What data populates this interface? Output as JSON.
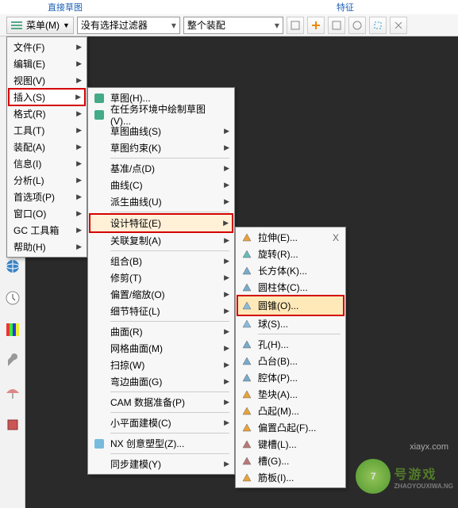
{
  "top": {
    "left": "直接草图",
    "right": "特征"
  },
  "toolbar": {
    "menu_label": "菜单(M)",
    "filter_label": "没有选择过滤器",
    "assembly_label": "整个装配"
  },
  "menu1": [
    {
      "label": "文件(F)",
      "arrow": true
    },
    {
      "label": "编辑(E)",
      "arrow": true
    },
    {
      "label": "视图(V)",
      "arrow": true
    },
    {
      "label": "插入(S)",
      "arrow": true,
      "hi": true
    },
    {
      "label": "格式(R)",
      "arrow": true
    },
    {
      "label": "工具(T)",
      "arrow": true
    },
    {
      "label": "装配(A)",
      "arrow": true
    },
    {
      "label": "信息(I)",
      "arrow": true
    },
    {
      "label": "分析(L)",
      "arrow": true
    },
    {
      "label": "首选项(P)",
      "arrow": true
    },
    {
      "label": "窗口(O)",
      "arrow": true
    },
    {
      "label": "GC 工具箱",
      "arrow": true
    },
    {
      "label": "帮助(H)",
      "arrow": true
    }
  ],
  "menu2": [
    {
      "t": "i",
      "label": "草图(H)...",
      "icon": "#4a8"
    },
    {
      "t": "i",
      "label": "在任务环境中绘制草图(V)...",
      "icon": "#4a8"
    },
    {
      "t": "i",
      "label": "草图曲线(S)",
      "arrow": true
    },
    {
      "t": "i",
      "label": "草图约束(K)",
      "arrow": true
    },
    {
      "t": "s"
    },
    {
      "t": "i",
      "label": "基准/点(D)",
      "arrow": true
    },
    {
      "t": "i",
      "label": "曲线(C)",
      "arrow": true
    },
    {
      "t": "i",
      "label": "派生曲线(U)",
      "arrow": true
    },
    {
      "t": "s"
    },
    {
      "t": "i",
      "label": "设计特征(E)",
      "arrow": true,
      "hi": true
    },
    {
      "t": "i",
      "label": "关联复制(A)",
      "arrow": true
    },
    {
      "t": "s"
    },
    {
      "t": "i",
      "label": "组合(B)",
      "arrow": true
    },
    {
      "t": "i",
      "label": "修剪(T)",
      "arrow": true
    },
    {
      "t": "i",
      "label": "偏置/缩放(O)",
      "arrow": true
    },
    {
      "t": "i",
      "label": "细节特征(L)",
      "arrow": true
    },
    {
      "t": "s"
    },
    {
      "t": "i",
      "label": "曲面(R)",
      "arrow": true
    },
    {
      "t": "i",
      "label": "网格曲面(M)",
      "arrow": true
    },
    {
      "t": "i",
      "label": "扫掠(W)",
      "arrow": true
    },
    {
      "t": "i",
      "label": "弯边曲面(G)",
      "arrow": true
    },
    {
      "t": "s"
    },
    {
      "t": "i",
      "label": "CAM 数据准备(P)",
      "arrow": true
    },
    {
      "t": "s"
    },
    {
      "t": "i",
      "label": "小平面建模(C)",
      "arrow": true
    },
    {
      "t": "s"
    },
    {
      "t": "i",
      "label": "NX 创意塑型(Z)...",
      "icon": "#7bd"
    },
    {
      "t": "s"
    },
    {
      "t": "i",
      "label": "同步建模(Y)",
      "arrow": true
    }
  ],
  "menu3": [
    {
      "t": "i",
      "label": "拉伸(E)...",
      "icon": "#e9a23b",
      "x": "X"
    },
    {
      "t": "i",
      "label": "旋转(R)...",
      "icon": "#6bb"
    },
    {
      "t": "i",
      "label": "长方体(K)...",
      "icon": "#7ac"
    },
    {
      "t": "i",
      "label": "圆柱体(C)...",
      "icon": "#7ac"
    },
    {
      "t": "i",
      "label": "圆锥(O)...",
      "icon": "#8bd",
      "hi": true
    },
    {
      "t": "i",
      "label": "球(S)...",
      "icon": "#8bd"
    },
    {
      "t": "s"
    },
    {
      "t": "i",
      "label": "孔(H)...",
      "icon": "#7ac"
    },
    {
      "t": "i",
      "label": "凸台(B)...",
      "icon": "#7ac"
    },
    {
      "t": "i",
      "label": "腔体(P)...",
      "icon": "#7ac"
    },
    {
      "t": "i",
      "label": "垫块(A)...",
      "icon": "#e9a23b"
    },
    {
      "t": "i",
      "label": "凸起(M)...",
      "icon": "#e9a23b"
    },
    {
      "t": "i",
      "label": "偏置凸起(F)...",
      "icon": "#e9a23b"
    },
    {
      "t": "i",
      "label": "键槽(L)...",
      "icon": "#b77"
    },
    {
      "t": "i",
      "label": "槽(G)...",
      "icon": "#b77"
    },
    {
      "t": "i",
      "label": "筋板(I)...",
      "icon": "#e9a23b"
    }
  ],
  "watermark": {
    "num": "7",
    "text": "号游戏",
    "sub": "ZHAOYOUXIWA.NG",
    "url": "xiayx.com"
  }
}
